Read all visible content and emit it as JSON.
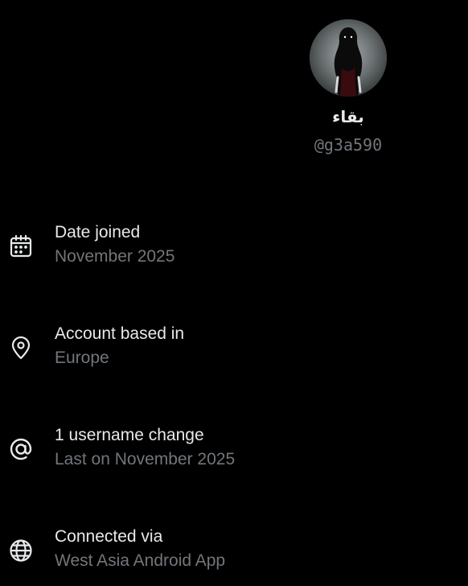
{
  "profile": {
    "display_name": "بقاء",
    "handle": "@g3a590"
  },
  "info_rows": [
    {
      "icon": "calendar-icon",
      "title": "Date joined",
      "subtitle": "November 2025"
    },
    {
      "icon": "location-pin-icon",
      "title": "Account based in",
      "subtitle": "Europe"
    },
    {
      "icon": "at-sign-icon",
      "title": "1 username change",
      "subtitle": "Last on November 2025"
    },
    {
      "icon": "globe-icon",
      "title": "Connected via",
      "subtitle": "West Asia Android App"
    }
  ],
  "colors": {
    "background": "#000000",
    "primary_text": "#e7e9ea",
    "secondary_text": "#71767b"
  }
}
